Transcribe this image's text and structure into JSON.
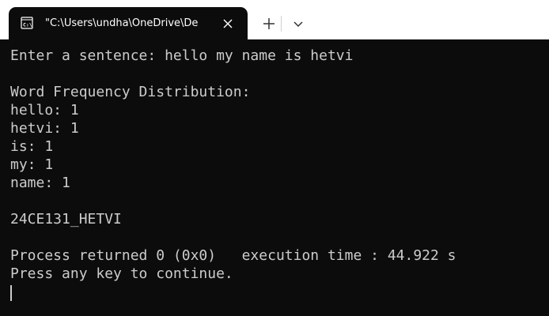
{
  "tab": {
    "title": "\"C:\\Users\\undha\\OneDrive\\De",
    "icon": "terminal-icon"
  },
  "controls": {
    "new_tab_icon": "plus-icon",
    "dropdown_icon": "chevron-down-icon",
    "close_icon": "close-icon"
  },
  "terminal": {
    "lines": [
      "Enter a sentence: hello my name is hetvi",
      "",
      "Word Frequency Distribution:",
      "hello: 1",
      "hetvi: 1",
      "is: 1",
      "my: 1",
      "name: 1",
      "",
      "24CE131_HETVI",
      "",
      "Process returned 0 (0x0)   execution time : 44.922 s",
      "Press any key to continue."
    ]
  },
  "colors": {
    "terminal_background": "#0c0c0c",
    "terminal_foreground": "#cccccc",
    "titlebar_background": "#ffffff"
  }
}
